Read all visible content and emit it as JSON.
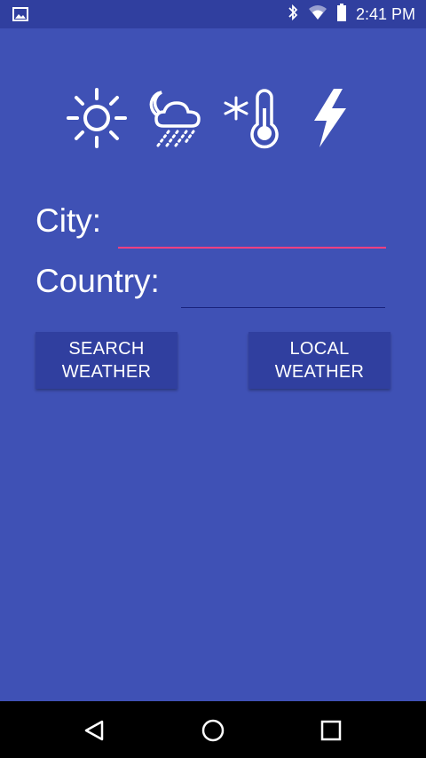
{
  "status_bar": {
    "time": "2:41 PM",
    "icons": [
      "gallery-icon",
      "bluetooth-icon",
      "wifi-icon",
      "battery-icon"
    ]
  },
  "weather_icons": [
    "sun-icon",
    "night-rain-cloud-icon",
    "snowflake-thermometer-icon",
    "lightning-icon"
  ],
  "form": {
    "city_label": "City:",
    "city_value": "",
    "country_label": "Country:",
    "country_value": ""
  },
  "buttons": {
    "search_line1": "SEARCH",
    "search_line2": "WEATHER",
    "local_line1": "LOCAL",
    "local_line2": "WEATHER"
  },
  "nav_bar": {
    "icons": [
      "back-icon",
      "home-icon",
      "recents-icon"
    ]
  },
  "colors": {
    "background": "#3f51b5",
    "status_bar": "#303f9f",
    "accent": "#ff4081",
    "button": "#303f9f"
  }
}
